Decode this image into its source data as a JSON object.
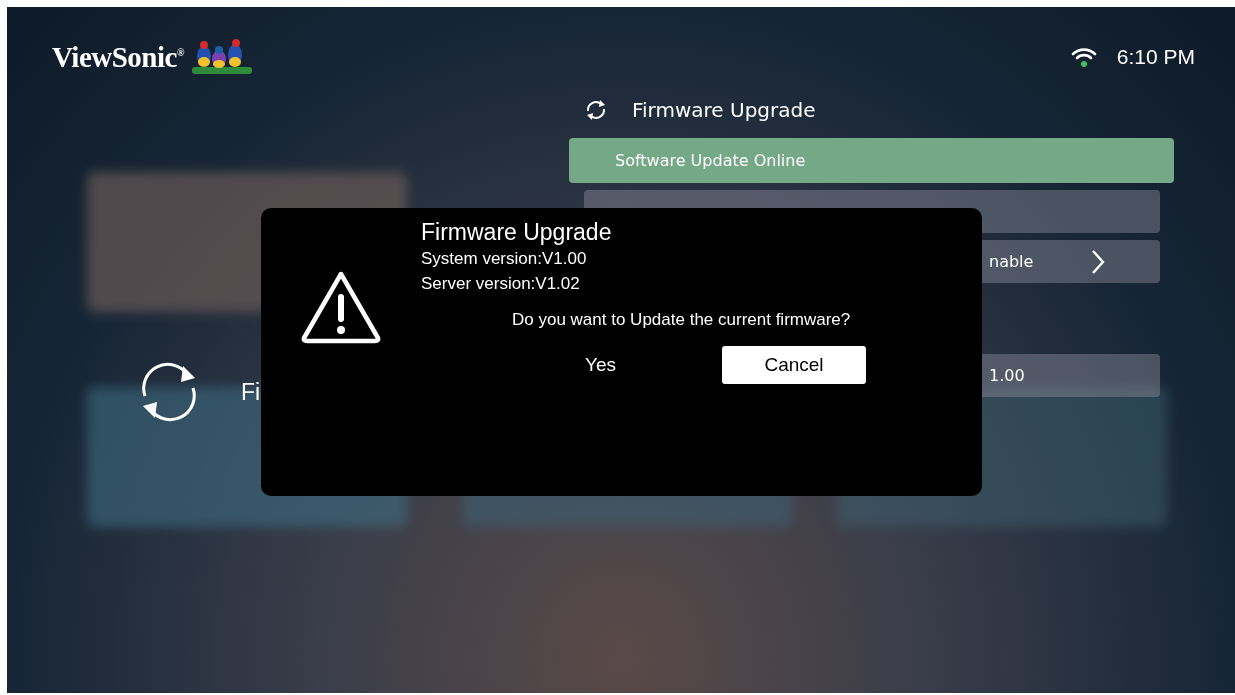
{
  "header": {
    "brand": "ViewSonic",
    "brand_mark": "®",
    "time": "6:10 PM"
  },
  "background_panel": {
    "label": "Fi"
  },
  "menu": {
    "title": "Firmware Upgrade",
    "items": [
      {
        "kind": "plain",
        "label": "Software Update Online",
        "selected": true
      },
      {
        "kind": "blank",
        "selected": false
      },
      {
        "kind": "link",
        "label": "nable",
        "selected": false
      },
      {
        "kind": "gap"
      },
      {
        "kind": "plain",
        "label": "1.00",
        "selected": false
      }
    ]
  },
  "dialog": {
    "title": "Firmware Upgrade",
    "lines": [
      "System version:V1.00",
      "Server version:V1.02"
    ],
    "question": "Do you want to Update the current firmware?",
    "buttons": [
      {
        "label": "Yes",
        "selected": false
      },
      {
        "label": "Cancel",
        "selected": true
      }
    ]
  }
}
